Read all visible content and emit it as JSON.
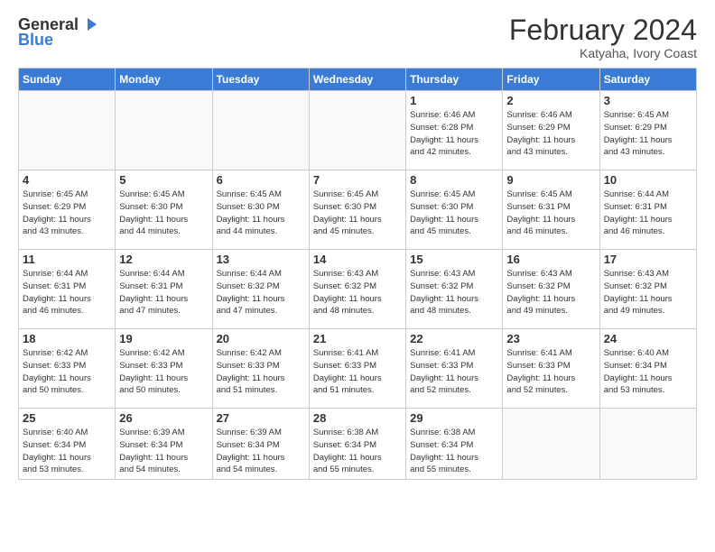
{
  "header": {
    "logo_general": "General",
    "logo_blue": "Blue",
    "month_title": "February 2024",
    "location": "Katyaha, Ivory Coast"
  },
  "weekdays": [
    "Sunday",
    "Monday",
    "Tuesday",
    "Wednesday",
    "Thursday",
    "Friday",
    "Saturday"
  ],
  "weeks": [
    [
      {
        "day": "",
        "info": ""
      },
      {
        "day": "",
        "info": ""
      },
      {
        "day": "",
        "info": ""
      },
      {
        "day": "",
        "info": ""
      },
      {
        "day": "1",
        "info": "Sunrise: 6:46 AM\nSunset: 6:28 PM\nDaylight: 11 hours\nand 42 minutes."
      },
      {
        "day": "2",
        "info": "Sunrise: 6:46 AM\nSunset: 6:29 PM\nDaylight: 11 hours\nand 43 minutes."
      },
      {
        "day": "3",
        "info": "Sunrise: 6:45 AM\nSunset: 6:29 PM\nDaylight: 11 hours\nand 43 minutes."
      }
    ],
    [
      {
        "day": "4",
        "info": "Sunrise: 6:45 AM\nSunset: 6:29 PM\nDaylight: 11 hours\nand 43 minutes."
      },
      {
        "day": "5",
        "info": "Sunrise: 6:45 AM\nSunset: 6:30 PM\nDaylight: 11 hours\nand 44 minutes."
      },
      {
        "day": "6",
        "info": "Sunrise: 6:45 AM\nSunset: 6:30 PM\nDaylight: 11 hours\nand 44 minutes."
      },
      {
        "day": "7",
        "info": "Sunrise: 6:45 AM\nSunset: 6:30 PM\nDaylight: 11 hours\nand 45 minutes."
      },
      {
        "day": "8",
        "info": "Sunrise: 6:45 AM\nSunset: 6:30 PM\nDaylight: 11 hours\nand 45 minutes."
      },
      {
        "day": "9",
        "info": "Sunrise: 6:45 AM\nSunset: 6:31 PM\nDaylight: 11 hours\nand 46 minutes."
      },
      {
        "day": "10",
        "info": "Sunrise: 6:44 AM\nSunset: 6:31 PM\nDaylight: 11 hours\nand 46 minutes."
      }
    ],
    [
      {
        "day": "11",
        "info": "Sunrise: 6:44 AM\nSunset: 6:31 PM\nDaylight: 11 hours\nand 46 minutes."
      },
      {
        "day": "12",
        "info": "Sunrise: 6:44 AM\nSunset: 6:31 PM\nDaylight: 11 hours\nand 47 minutes."
      },
      {
        "day": "13",
        "info": "Sunrise: 6:44 AM\nSunset: 6:32 PM\nDaylight: 11 hours\nand 47 minutes."
      },
      {
        "day": "14",
        "info": "Sunrise: 6:43 AM\nSunset: 6:32 PM\nDaylight: 11 hours\nand 48 minutes."
      },
      {
        "day": "15",
        "info": "Sunrise: 6:43 AM\nSunset: 6:32 PM\nDaylight: 11 hours\nand 48 minutes."
      },
      {
        "day": "16",
        "info": "Sunrise: 6:43 AM\nSunset: 6:32 PM\nDaylight: 11 hours\nand 49 minutes."
      },
      {
        "day": "17",
        "info": "Sunrise: 6:43 AM\nSunset: 6:32 PM\nDaylight: 11 hours\nand 49 minutes."
      }
    ],
    [
      {
        "day": "18",
        "info": "Sunrise: 6:42 AM\nSunset: 6:33 PM\nDaylight: 11 hours\nand 50 minutes."
      },
      {
        "day": "19",
        "info": "Sunrise: 6:42 AM\nSunset: 6:33 PM\nDaylight: 11 hours\nand 50 minutes."
      },
      {
        "day": "20",
        "info": "Sunrise: 6:42 AM\nSunset: 6:33 PM\nDaylight: 11 hours\nand 51 minutes."
      },
      {
        "day": "21",
        "info": "Sunrise: 6:41 AM\nSunset: 6:33 PM\nDaylight: 11 hours\nand 51 minutes."
      },
      {
        "day": "22",
        "info": "Sunrise: 6:41 AM\nSunset: 6:33 PM\nDaylight: 11 hours\nand 52 minutes."
      },
      {
        "day": "23",
        "info": "Sunrise: 6:41 AM\nSunset: 6:33 PM\nDaylight: 11 hours\nand 52 minutes."
      },
      {
        "day": "24",
        "info": "Sunrise: 6:40 AM\nSunset: 6:34 PM\nDaylight: 11 hours\nand 53 minutes."
      }
    ],
    [
      {
        "day": "25",
        "info": "Sunrise: 6:40 AM\nSunset: 6:34 PM\nDaylight: 11 hours\nand 53 minutes."
      },
      {
        "day": "26",
        "info": "Sunrise: 6:39 AM\nSunset: 6:34 PM\nDaylight: 11 hours\nand 54 minutes."
      },
      {
        "day": "27",
        "info": "Sunrise: 6:39 AM\nSunset: 6:34 PM\nDaylight: 11 hours\nand 54 minutes."
      },
      {
        "day": "28",
        "info": "Sunrise: 6:38 AM\nSunset: 6:34 PM\nDaylight: 11 hours\nand 55 minutes."
      },
      {
        "day": "29",
        "info": "Sunrise: 6:38 AM\nSunset: 6:34 PM\nDaylight: 11 hours\nand 55 minutes."
      },
      {
        "day": "",
        "info": ""
      },
      {
        "day": "",
        "info": ""
      }
    ]
  ]
}
